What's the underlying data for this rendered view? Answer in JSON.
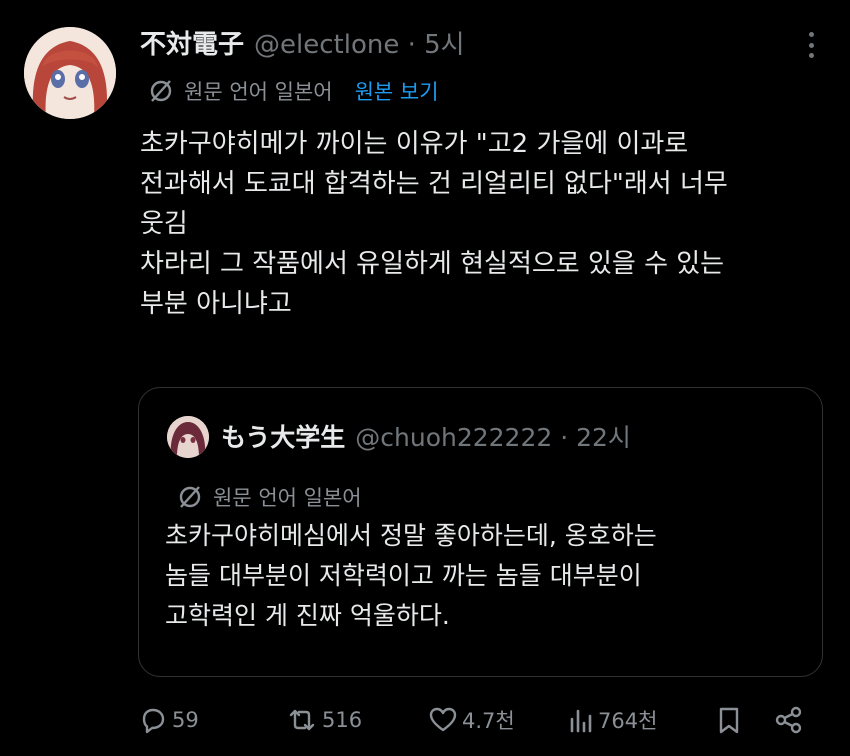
{
  "tweet": {
    "author_name": "不対電子",
    "author_handle": "@electlone · 5시",
    "translate_label": "원문 언어 일본어",
    "view_original": "원본 보기",
    "lines": [
      "초카구야히메가 까이는 이유가 \"고2 가을에 이과로",
      "전과해서 도쿄대 합격하는 건 리얼리티 없다\"래서 너무",
      "웃김",
      "차라리 그 작품에서 유일하게 현실적으로 있을 수 있는",
      "부분 아니냐고"
    ]
  },
  "quote": {
    "author_name": "もう大学生",
    "author_handle": "@chuoh222222 · 22시",
    "translate_label": "원문 언어 일본어",
    "lines": [
      "초카구야히메심에서 정말 좋아하는데, 옹호하는",
      "놈들 대부분이 저학력이고 까는 놈들 대부분이",
      "고학력인 게 진짜 억울하다."
    ]
  },
  "actions": {
    "replies": "59",
    "reposts": "516",
    "likes": "4.7천",
    "views": "764천"
  },
  "icons": [
    "more-icon",
    "translate-icon",
    "reply-icon",
    "repost-icon",
    "like-icon",
    "views-icon",
    "bookmark-icon",
    "share-icon"
  ],
  "colors": {
    "background": "#000000",
    "text": "#e7e9ea",
    "muted": "#71767b",
    "link": "#1d9bf0"
  }
}
